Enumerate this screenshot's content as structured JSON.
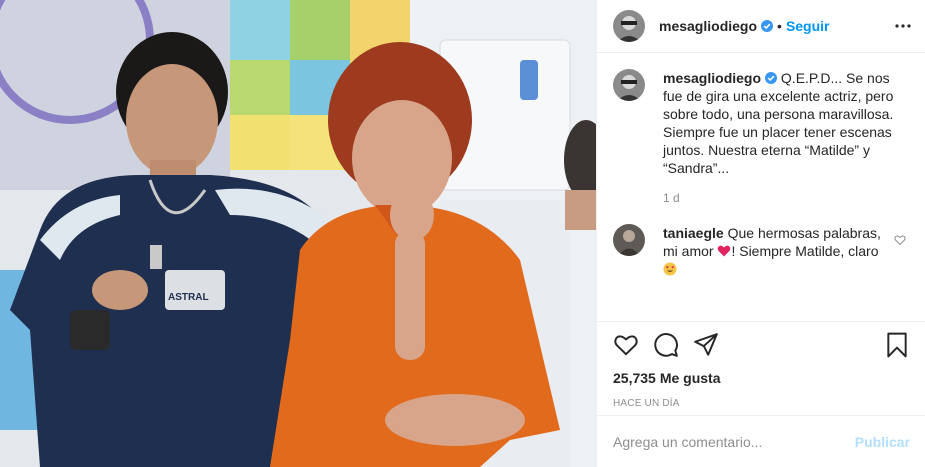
{
  "header": {
    "username": "mesagliodiego",
    "verified_icon": "verified-badge-icon",
    "separator": "•",
    "follow_label": "Seguir",
    "more_icon": "more-options-icon"
  },
  "caption": {
    "username": "mesagliodiego",
    "text": "Q.E.P.D... Se nos fue de gira una excelente actriz, pero sobre todo, una persona maravillosa. Siempre fue un placer tener escenas juntos. Nuestra eterna “Matilde” y “Sandra”...",
    "age": "1 d"
  },
  "comments": [
    {
      "username": "taniaegle",
      "text_before": "Que hermosas palabras, mi amor",
      "emoji_1": "red-heart-emoji",
      "text_middle": "! Siempre Matilde, claro",
      "emoji_2": "heart-eyes-emoji",
      "like_icon": "heart-outline-icon"
    }
  ],
  "actions": {
    "like_icon": "heart-outline-icon",
    "comment_icon": "comment-bubble-icon",
    "share_icon": "paper-plane-icon",
    "save_icon": "bookmark-icon",
    "likes_count": "25,735",
    "likes_label": "Me gusta",
    "timestamp": "HACE UN DÍA"
  },
  "add_comment": {
    "placeholder": "Agrega un comentario...",
    "publish_label": "Publicar"
  },
  "colors": {
    "accent": "#0095f6",
    "publish_disabled": "#b2dffc",
    "verified": "#3897f0",
    "secondary_text": "#8e8e8e"
  }
}
